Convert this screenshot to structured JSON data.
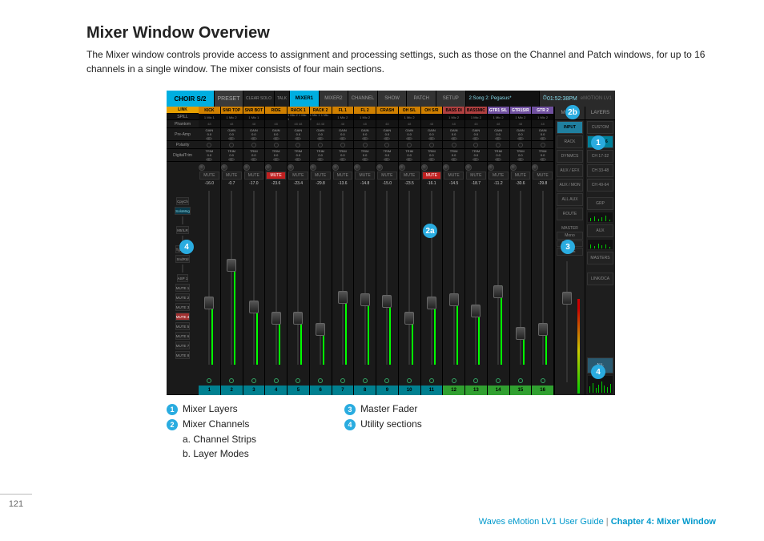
{
  "page_number": "121",
  "title": "Mixer Window Overview",
  "intro": "The Mixer window controls provide access to assignment and processing settings, such as those on the Channel and Patch windows, for up to 16 channels in a single window. The mixer consists of four main sections.",
  "topbar": {
    "channel_name": "CHOIR S/2",
    "preset": "PRESET",
    "clear_solo": "CLEAR\nSOLO",
    "talk": "TALK",
    "tabs": [
      "MIXER1",
      "MIXER2",
      "CHANNEL",
      "SHOW",
      "PATCH",
      "SETUP"
    ],
    "active_tab": 0,
    "scene": "2:Song 2: Pegasus*",
    "clock": "01:52:38PM",
    "logo": "eMOTION LV1"
  },
  "row_labels": {
    "link": "LINK",
    "spill": "SPILL",
    "linknum": "LINK 1",
    "phantom": "Phantom",
    "preamp": "Pre-Amp",
    "polarity": "Polarity",
    "digital": "Digital",
    "trim": "Trim"
  },
  "side_buttons": [
    "CpyCh",
    "SoloMng",
    "",
    "Mtr/LR",
    "",
    "TglCalm",
    "SndRtd",
    "",
    "ASP 1",
    "MUTE 1",
    "MUTE 2",
    "MUTE 3",
    "MUTE 4",
    "MUTE 5",
    "MUTE 6",
    "MUTE 7",
    "MUTE 8"
  ],
  "layer_col_side": "LAYER",
  "channels": [
    {
      "name": "KICK",
      "io": "1 Mic 1",
      "color": "or",
      "phantom": "48",
      "gain": "0.0",
      "trim": "0.0",
      "mute": false,
      "db": "-16.0",
      "fader": 58,
      "meter": 35
    },
    {
      "name": "SNR TOP",
      "io": "1 Mic 2",
      "color": "or",
      "phantom": "48",
      "gain": "0.0",
      "trim": "0.0",
      "mute": false,
      "db": "-0.7",
      "fader": 38,
      "meter": 55
    },
    {
      "name": "SNR BOT",
      "io": "1 Mic 1",
      "color": "or",
      "phantom": "48",
      "gain": "0.0",
      "trim": "0.0",
      "mute": false,
      "db": "-17.0",
      "fader": 60,
      "meter": 32
    },
    {
      "name": "RIDE",
      "io": "",
      "color": "or",
      "phantom": "48",
      "gain": "0.0",
      "trim": "0.0",
      "mute": true,
      "db": "-23.6",
      "fader": 66,
      "meter": 22
    },
    {
      "name": "RACK 1",
      "io": "1 Mic 2\n1 Mic 1",
      "color": "or",
      "phantom": "48  48",
      "gain": "0.0",
      "trim": "0.0",
      "mute": false,
      "db": "-23.4",
      "fader": 66,
      "meter": 24
    },
    {
      "name": "RACK 2",
      "io": "1 Mic 1\n1 Mic 2",
      "color": "or",
      "phantom": "48  48",
      "gain": "0.0",
      "trim": "0.0",
      "mute": false,
      "db": "-29.8",
      "fader": 72,
      "meter": 16
    },
    {
      "name": "FL 1",
      "io": "1 Mic 2",
      "color": "or",
      "phantom": "48",
      "gain": "0.0",
      "trim": "0.0",
      "mute": false,
      "db": "-13.6",
      "fader": 55,
      "meter": 38
    },
    {
      "name": "FL 2",
      "io": "1 Mic 2",
      "color": "or",
      "phantom": "48",
      "gain": "0.0",
      "trim": "0.0",
      "mute": false,
      "db": "-14.8",
      "fader": 56,
      "meter": 36
    },
    {
      "name": "CRASH",
      "io": "",
      "color": "or",
      "phantom": "48",
      "gain": "0.0",
      "trim": "0.0",
      "mute": false,
      "db": "-15.0",
      "fader": 57,
      "meter": 34
    },
    {
      "name": "OH S/L",
      "io": "1 Mic 2",
      "color": "or",
      "phantom": "48",
      "gain": "0.0",
      "trim": "0.0",
      "mute": false,
      "db": "-23.5",
      "fader": 66,
      "meter": 22
    },
    {
      "name": "OH S/R",
      "io": "",
      "color": "or",
      "phantom": "48",
      "gain": "0.0",
      "trim": "0.0",
      "mute": true,
      "db": "-16.1",
      "fader": 58,
      "meter": 30
    },
    {
      "name": "BASS DI",
      "io": "1 Mic 2",
      "color": "rd",
      "phantom": "48",
      "gain": "0.0",
      "trim": "0.0",
      "mute": false,
      "db": "-14.5",
      "fader": 56,
      "meter": 36
    },
    {
      "name": "BASSMIC",
      "io": "1 Mic 2",
      "color": "rd",
      "phantom": "48",
      "gain": "0.0",
      "trim": "0.0",
      "mute": false,
      "db": "-18.7",
      "fader": 62,
      "meter": 28
    },
    {
      "name": "GTR1 S/L",
      "io": "1 Mic 2",
      "color": "pu",
      "phantom": "48",
      "gain": "0.0",
      "trim": "0.0",
      "mute": false,
      "db": "-11.2",
      "fader": 52,
      "meter": 42
    },
    {
      "name": "GTR1S/R",
      "io": "1 Mic 2",
      "color": "pu",
      "phantom": "48",
      "gain": "0.0",
      "trim": "0.0",
      "mute": false,
      "db": "-30.6",
      "fader": 74,
      "meter": 14
    },
    {
      "name": "GTR 2",
      "io": "1 Mic 2",
      "color": "pu",
      "phantom": "48",
      "gain": "0.0",
      "trim": "0.0",
      "mute": false,
      "db": "-29.8",
      "fader": 72,
      "meter": 16
    }
  ],
  "gain_label": "GAIN",
  "trim_label": "TRIM",
  "mute_label": "MUTE",
  "modes_col": {
    "header": "MODES",
    "buttons": [
      "INPUT",
      "RACK",
      "DYNMCS",
      "AUX / EFX",
      "AUX / MON",
      "ALL AUX",
      "ROUTE"
    ],
    "master": "MASTER",
    "mono": "Mono",
    "c_label": "C",
    "mute": "MUTE"
  },
  "layers_col": {
    "header": "LAYERS",
    "custom": "CUSTOM",
    "buttons": [
      "CH 1-16",
      "CH 17-32",
      "CH 33-48",
      "CH 49-64",
      "GRP",
      "AUX",
      "MASTERS",
      "LINK/DCA",
      "ALL"
    ]
  },
  "bubbles": {
    "b1": "1",
    "b2a": "2a",
    "b2b": "2b",
    "b3": "3",
    "b4": "4",
    "b4b": "4"
  },
  "legend": {
    "i1": "Mixer Layers",
    "i2": "Mixer Channels",
    "i2a": "a. Channel Strips",
    "i2b": "b. Layer Modes",
    "i3": "Master Fader",
    "i4": "Utility sections"
  },
  "footer": {
    "t1": "Waves eMotion LV1 User Guide",
    "t2": "Chapter 4: Mixer Window"
  }
}
